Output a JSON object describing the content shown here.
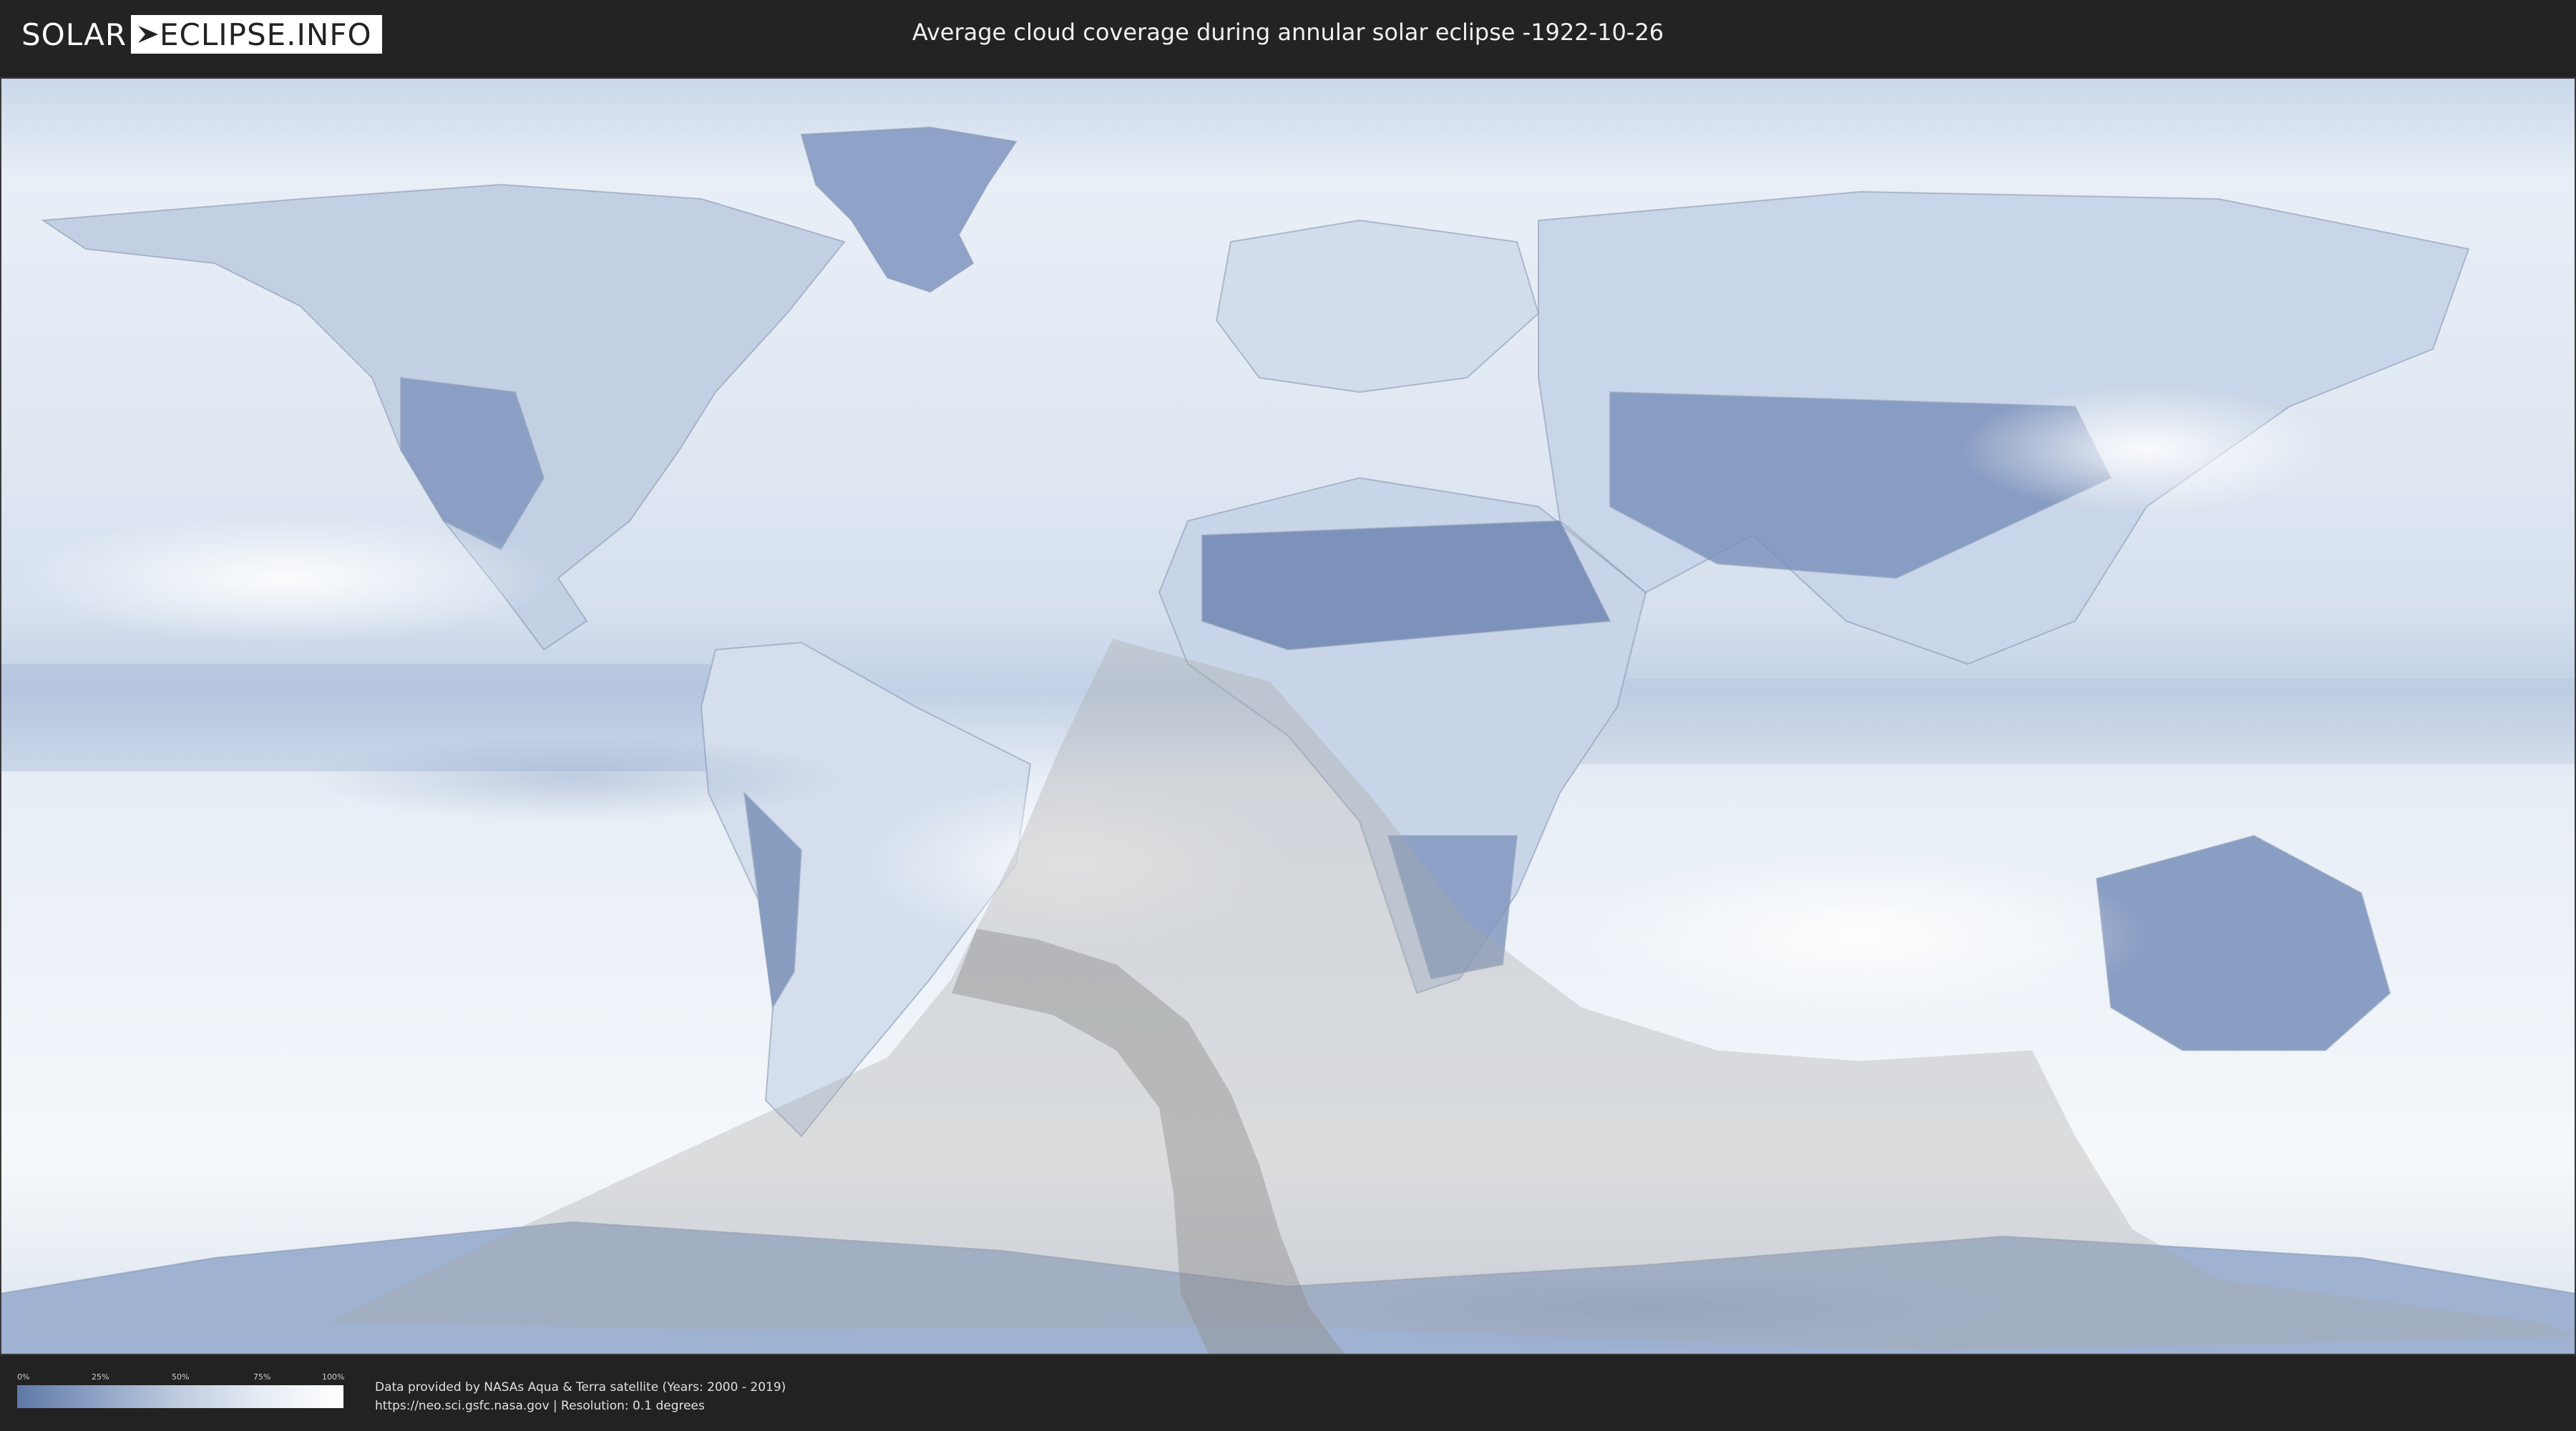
{
  "header": {
    "logo_part1": "SOLAR",
    "logo_part2": "ECLIPSE.INFO",
    "title": "Average cloud coverage during annular solar eclipse -1922-10-26"
  },
  "map": {
    "type": "cloud-coverage-world-map",
    "projection": "equirectangular",
    "overlay_color": "#a9a9a9"
  },
  "legend": {
    "ticks": [
      "0%",
      "25%",
      "50%",
      "75%",
      "100%"
    ],
    "colors": [
      "#5f79a6",
      "#8fa3c6",
      "#c0cde0",
      "#e6ecf4",
      "#ffffff"
    ]
  },
  "credits": {
    "line1": "Data provided by NASAs Aqua & Terra satellite (Years: 2000 - 2019)",
    "line2": "https://neo.sci.gsfc.nasa.gov | Resolution: 0.1 degrees"
  }
}
